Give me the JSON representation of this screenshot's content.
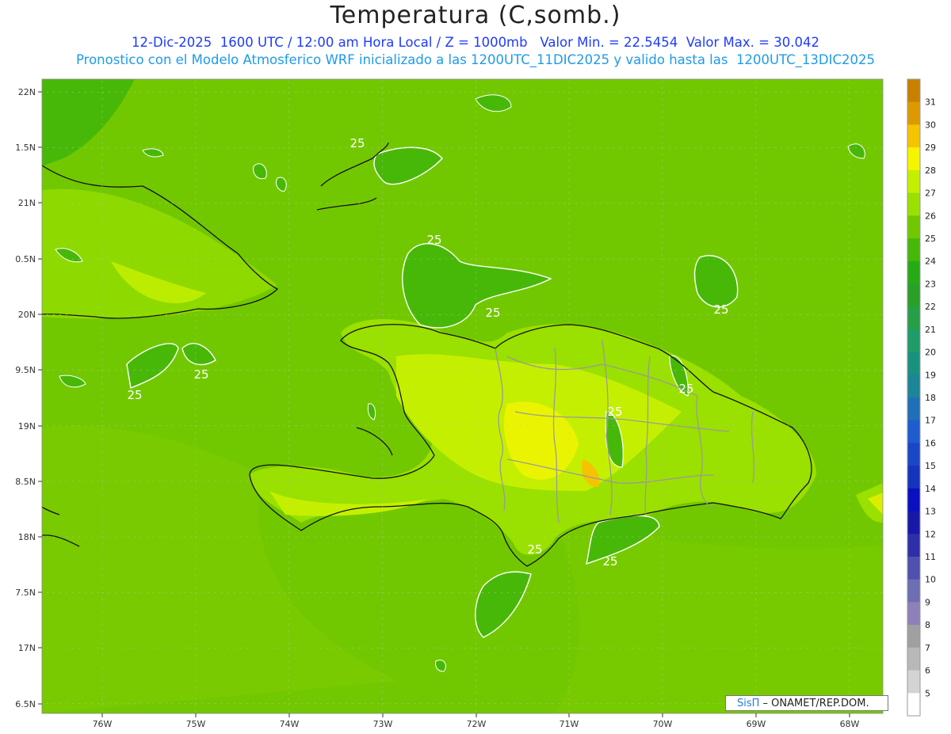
{
  "header": {
    "title": "Temperatura (C,somb.)",
    "line1": "12-Dic-2025  1600 UTC / 12:00 am Hora Local / Z = 1000mb   Valor Min. = 22.5454  Valor Max. = 30.042",
    "line2": "Pronostico con el Modelo Atmosferico WRF inicializado a las 1200UTC_11DIC2025 y valido hasta las  1200UTC_13DIC2025"
  },
  "axes": {
    "lat_labels": [
      "22N",
      "1.5N",
      "21N",
      "0.5N",
      "20N",
      "9.5N",
      "19N",
      "8.5N",
      "18N",
      "7.5N",
      "17N",
      "6.5N"
    ],
    "lon_labels": [
      "76W",
      "75W",
      "74W",
      "73W",
      "72W",
      "71W",
      "70W",
      "69W",
      "68W"
    ]
  },
  "contour_labels": [
    "25",
    "25",
    "25",
    "25",
    "25",
    "25",
    "25",
    "25",
    "25",
    "25",
    "25",
    "25"
  ],
  "colorbar": {
    "labels": [
      "31",
      "30",
      "29",
      "28",
      "27",
      "26",
      "25",
      "24",
      "23",
      "22",
      "21",
      "20",
      "19",
      "18",
      "17",
      "16",
      "15",
      "14",
      "13",
      "12",
      "11",
      "10",
      "9",
      "8",
      "7",
      "6",
      "5"
    ],
    "colors": [
      "#c88000",
      "#dc9a00",
      "#f5c400",
      "#f5f500",
      "#c4f000",
      "#9ae000",
      "#72c800",
      "#48b808",
      "#26ab16",
      "#2aa028",
      "#26a048",
      "#1e9c6a",
      "#18927e",
      "#1a8698",
      "#1f70b8",
      "#1e5cd0",
      "#1a46c8",
      "#1434bc",
      "#0a10c0",
      "#1818a8",
      "#2e2ea8",
      "#5050b0",
      "#6e6eb4",
      "#8e80b8",
      "#a0a0a0",
      "#b8b8b8",
      "#d4d4d4",
      "#ffffff"
    ]
  },
  "credit": {
    "brand": "SisΠ",
    "rest": " – ONAMET/REP.DOM."
  }
}
